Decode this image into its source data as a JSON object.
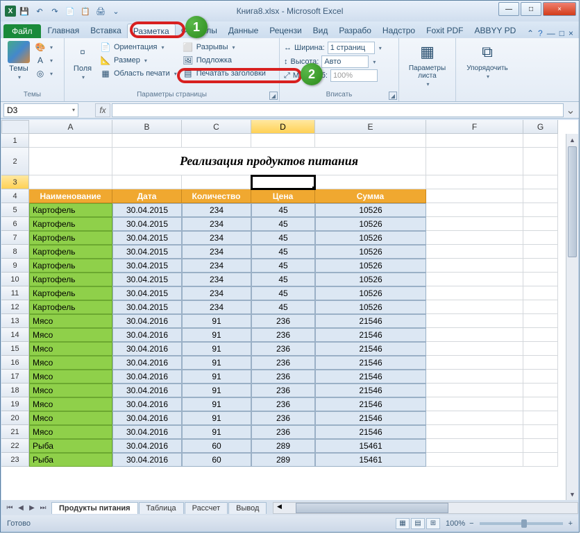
{
  "window": {
    "title": "Книга8.xlsx - Microsoft Excel",
    "min": "—",
    "max": "□",
    "close": "×"
  },
  "qat": [
    "💾",
    "↶",
    "↷",
    "📄",
    "📋",
    "🖨",
    "⌄"
  ],
  "tabs": {
    "file": "Файл",
    "list": [
      "Главная",
      "Вставка",
      "Разметка",
      "Формулы",
      "Данные",
      "Рецензи",
      "Вид",
      "Разрабо",
      "Надстро",
      "Foxit PDF",
      "ABBYY PD"
    ],
    "active_index": 2
  },
  "ribbon": {
    "themes": {
      "label": "Темы",
      "btn": "Темы"
    },
    "page_setup": {
      "label": "Параметры страницы",
      "margins": "Поля",
      "orientation": "Ориентация",
      "size": "Размер",
      "print_area": "Область печати",
      "breaks": "Разрывы",
      "background": "Подложка",
      "print_titles": "Печатать заголовки"
    },
    "scale": {
      "label": "Вписать",
      "width_lbl": "Ширина:",
      "width_val": "1 страниц",
      "height_lbl": "Высота:",
      "height_val": "Авто",
      "scale_lbl": "Масштаб:",
      "scale_val": "100%"
    },
    "sheet_opts": {
      "label": "",
      "btn": "Параметры листа"
    },
    "arrange": {
      "label": "",
      "btn": "Упорядочить"
    }
  },
  "namebox": "D3",
  "columns": [
    "A",
    "B",
    "C",
    "D",
    "E",
    "F",
    "G"
  ],
  "col_widths": [
    "wA",
    "wB",
    "wC",
    "wD",
    "wE",
    "wF",
    "wG"
  ],
  "selected_col_index": 3,
  "row_numbers": [
    1,
    2,
    3,
    4,
    5,
    6,
    7,
    8,
    9,
    10,
    11,
    12,
    13,
    14,
    15,
    16,
    17,
    18,
    19,
    20,
    21,
    22,
    23
  ],
  "selected_row": 3,
  "title_row": "Реализация продуктов питания",
  "headers": [
    "Наименование",
    "Дата",
    "Количество",
    "Цена",
    "Сумма"
  ],
  "chart_data": {
    "type": "table",
    "columns": [
      "Наименование",
      "Дата",
      "Количество",
      "Цена",
      "Сумма"
    ],
    "rows": [
      [
        "Картофель",
        "30.04.2015",
        234,
        45,
        10526
      ],
      [
        "Картофель",
        "30.04.2015",
        234,
        45,
        10526
      ],
      [
        "Картофель",
        "30.04.2015",
        234,
        45,
        10526
      ],
      [
        "Картофель",
        "30.04.2015",
        234,
        45,
        10526
      ],
      [
        "Картофель",
        "30.04.2015",
        234,
        45,
        10526
      ],
      [
        "Картофель",
        "30.04.2015",
        234,
        45,
        10526
      ],
      [
        "Картофель",
        "30.04.2015",
        234,
        45,
        10526
      ],
      [
        "Картофель",
        "30.04.2015",
        234,
        45,
        10526
      ],
      [
        "Мясо",
        "30.04.2016",
        91,
        236,
        21546
      ],
      [
        "Мясо",
        "30.04.2016",
        91,
        236,
        21546
      ],
      [
        "Мясо",
        "30.04.2016",
        91,
        236,
        21546
      ],
      [
        "Мясо",
        "30.04.2016",
        91,
        236,
        21546
      ],
      [
        "Мясо",
        "30.04.2016",
        91,
        236,
        21546
      ],
      [
        "Мясо",
        "30.04.2016",
        91,
        236,
        21546
      ],
      [
        "Мясо",
        "30.04.2016",
        91,
        236,
        21546
      ],
      [
        "Мясо",
        "30.04.2016",
        91,
        236,
        21546
      ],
      [
        "Мясо",
        "30.04.2016",
        91,
        236,
        21546
      ],
      [
        "Рыба",
        "30.04.2016",
        60,
        289,
        15461
      ],
      [
        "Рыба",
        "30.04.2016",
        60,
        289,
        15461
      ]
    ]
  },
  "sheet_tabs": [
    "Продукты питания",
    "Таблица",
    "Рассчет",
    "Вывод"
  ],
  "active_sheet": 0,
  "status": "Готово",
  "zoom": "100%",
  "callout1": "1",
  "callout2": "2"
}
